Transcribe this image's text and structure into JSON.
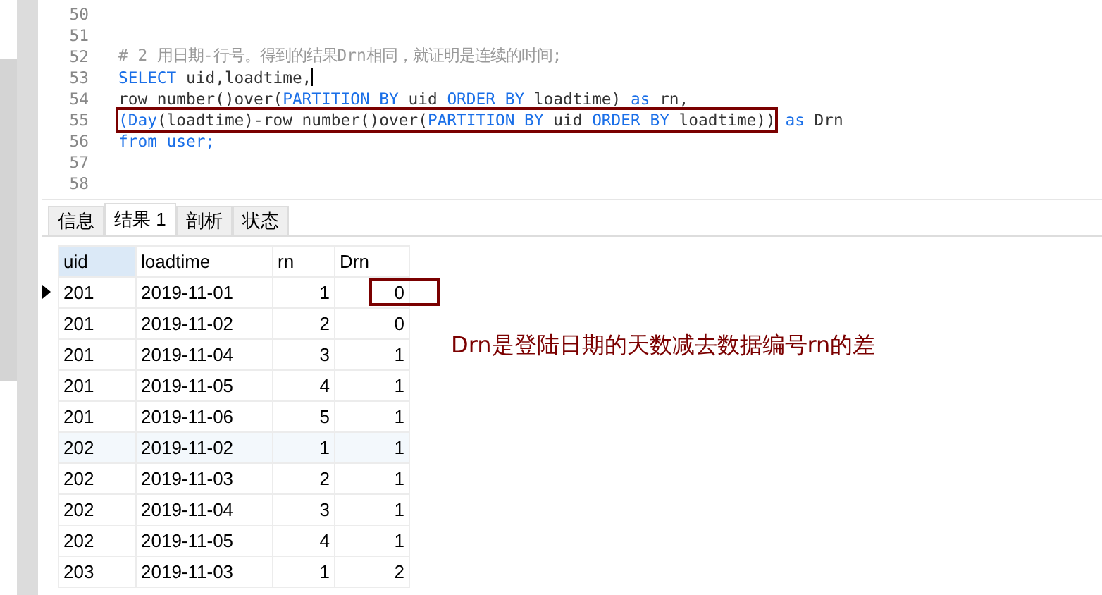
{
  "editor": {
    "lines": [
      {
        "number": "50"
      },
      {
        "number": "51"
      },
      {
        "number": "52",
        "tokens": [
          {
            "text": "# 2 用日期-行号。得到的结果Drn相同，就证明是连续的时间;",
            "kind": "comment"
          }
        ]
      },
      {
        "number": "53",
        "cursor": true,
        "tokens": [
          {
            "text": "SELECT",
            "kind": "keyword"
          },
          {
            "text": " uid,loadtime,",
            "kind": "plain"
          }
        ]
      },
      {
        "number": "54",
        "tokens": [
          {
            "text": "row number()over(",
            "kind": "plain"
          },
          {
            "text": "PARTITION BY",
            "kind": "keyword"
          },
          {
            "text": " uid ",
            "kind": "plain"
          },
          {
            "text": "ORDER BY",
            "kind": "keyword"
          },
          {
            "text": " loadtime) ",
            "kind": "plain"
          },
          {
            "text": "as",
            "kind": "keyword"
          },
          {
            "text": " rn,",
            "kind": "plain"
          }
        ]
      },
      {
        "number": "55",
        "boxed": [
          {
            "text": "(Day",
            "kind": "keyword"
          },
          {
            "text": "(loadtime)-row number()over(",
            "kind": "plain"
          },
          {
            "text": "PARTITION BY",
            "kind": "keyword"
          },
          {
            "text": " uid ",
            "kind": "plain"
          },
          {
            "text": "ORDER BY",
            "kind": "keyword"
          },
          {
            "text": " loadtime))",
            "kind": "plain"
          }
        ],
        "tokens": [
          {
            "text": " as",
            "kind": "keyword"
          },
          {
            "text": " Drn",
            "kind": "plain"
          }
        ]
      },
      {
        "number": "56",
        "tokens": [
          {
            "text": "from",
            "kind": "keyword"
          },
          {
            "text": " user;",
            "kind": "keyword"
          }
        ]
      },
      {
        "number": "57"
      },
      {
        "number": "58"
      }
    ]
  },
  "tabs": [
    {
      "label": "信息",
      "selected": false
    },
    {
      "label": "结果 1",
      "selected": true
    },
    {
      "label": "剖析",
      "selected": false
    },
    {
      "label": "状态",
      "selected": false
    }
  ],
  "table": {
    "columns": [
      {
        "label": "uid",
        "selected": true,
        "kind": "text"
      },
      {
        "label": "loadtime",
        "selected": false,
        "kind": "text"
      },
      {
        "label": "rn",
        "selected": false,
        "kind": "number"
      },
      {
        "label": "Drn",
        "selected": false,
        "kind": "number"
      }
    ],
    "rows": [
      {
        "selected": true,
        "hovered": false,
        "cells": [
          "201",
          "2019-11-01",
          "1",
          "0"
        ]
      },
      {
        "selected": false,
        "hovered": false,
        "cells": [
          "201",
          "2019-11-02",
          "2",
          "0"
        ]
      },
      {
        "selected": false,
        "hovered": false,
        "cells": [
          "201",
          "2019-11-04",
          "3",
          "1"
        ]
      },
      {
        "selected": false,
        "hovered": false,
        "cells": [
          "201",
          "2019-11-05",
          "4",
          "1"
        ]
      },
      {
        "selected": false,
        "hovered": false,
        "cells": [
          "201",
          "2019-11-06",
          "5",
          "1"
        ]
      },
      {
        "selected": false,
        "hovered": true,
        "cells": [
          "202",
          "2019-11-02",
          "1",
          "1"
        ]
      },
      {
        "selected": false,
        "hovered": false,
        "cells": [
          "202",
          "2019-11-03",
          "2",
          "1"
        ]
      },
      {
        "selected": false,
        "hovered": false,
        "cells": [
          "202",
          "2019-11-04",
          "3",
          "1"
        ]
      },
      {
        "selected": false,
        "hovered": false,
        "cells": [
          "202",
          "2019-11-05",
          "4",
          "1"
        ]
      },
      {
        "selected": false,
        "hovered": false,
        "cells": [
          "203",
          "2019-11-03",
          "1",
          "2"
        ]
      }
    ]
  },
  "annotation": "Drn是登陆日期的天数减去数据编号rn的差"
}
